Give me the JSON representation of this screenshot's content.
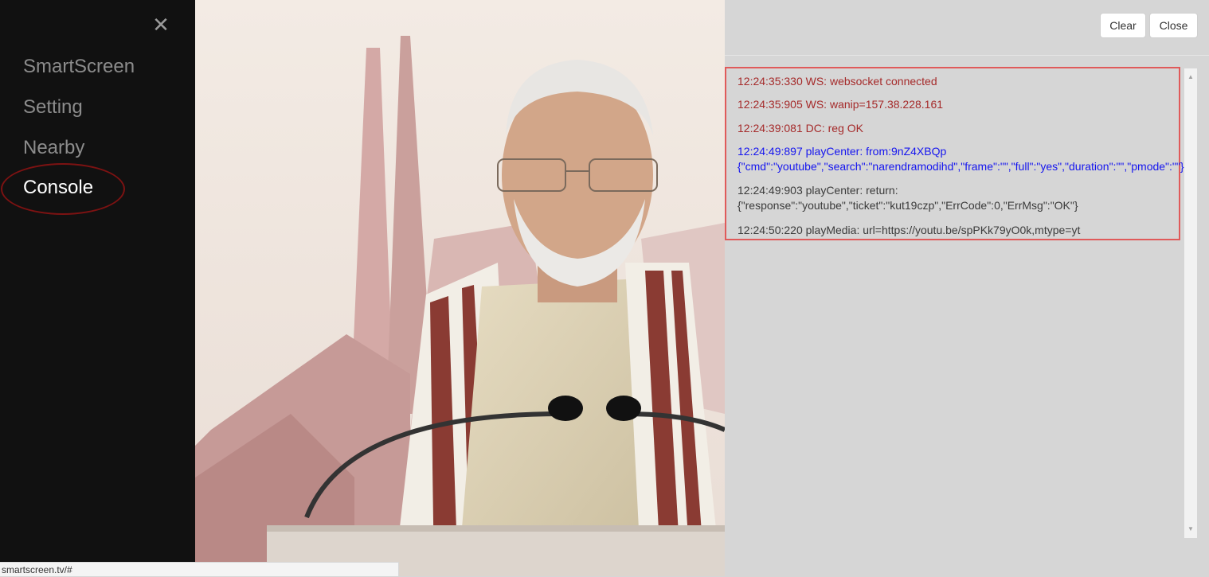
{
  "sidebar": {
    "close_icon": "close-icon",
    "items": [
      {
        "label": "SmartScreen"
      },
      {
        "label": "Setting"
      },
      {
        "label": "Nearby"
      },
      {
        "label": "Console"
      }
    ],
    "active_index": 3
  },
  "toolbar": {
    "clear_label": "Clear",
    "close_label": "Close"
  },
  "console": {
    "lines": [
      {
        "text": "12:24:35:330 WS: websocket connected",
        "color": "#a52a2a"
      },
      {
        "text": "12:24:35:905 WS: wanip=157.38.228.161",
        "color": "#a52a2a"
      },
      {
        "text": "12:24:39:081 DC: reg OK",
        "color": "#a52a2a"
      },
      {
        "text": "12:24:49:897 playCenter: from:9nZ4XBQp",
        "text2": "{\"cmd\":\"youtube\",\"search\":\"narendramodihd\",\"frame\":\"\",\"full\":\"yes\",\"duration\":\"\",\"pmode\":\"\"}",
        "color": "#1515ef"
      },
      {
        "text": "12:24:49:903 playCenter: return:",
        "text2": "{\"response\":\"youtube\",\"ticket\":\"kut19czp\",\"ErrCode\":0,\"ErrMsg\":\"OK\"}",
        "color": "#3b3b3b"
      },
      {
        "text": "12:24:50:220 playMedia: url=https://youtu.be/spPKk79yO0k,mtype=yt",
        "color": "#3b3b3b"
      }
    ]
  },
  "status_bar": {
    "url": "smartscreen.tv/#"
  }
}
